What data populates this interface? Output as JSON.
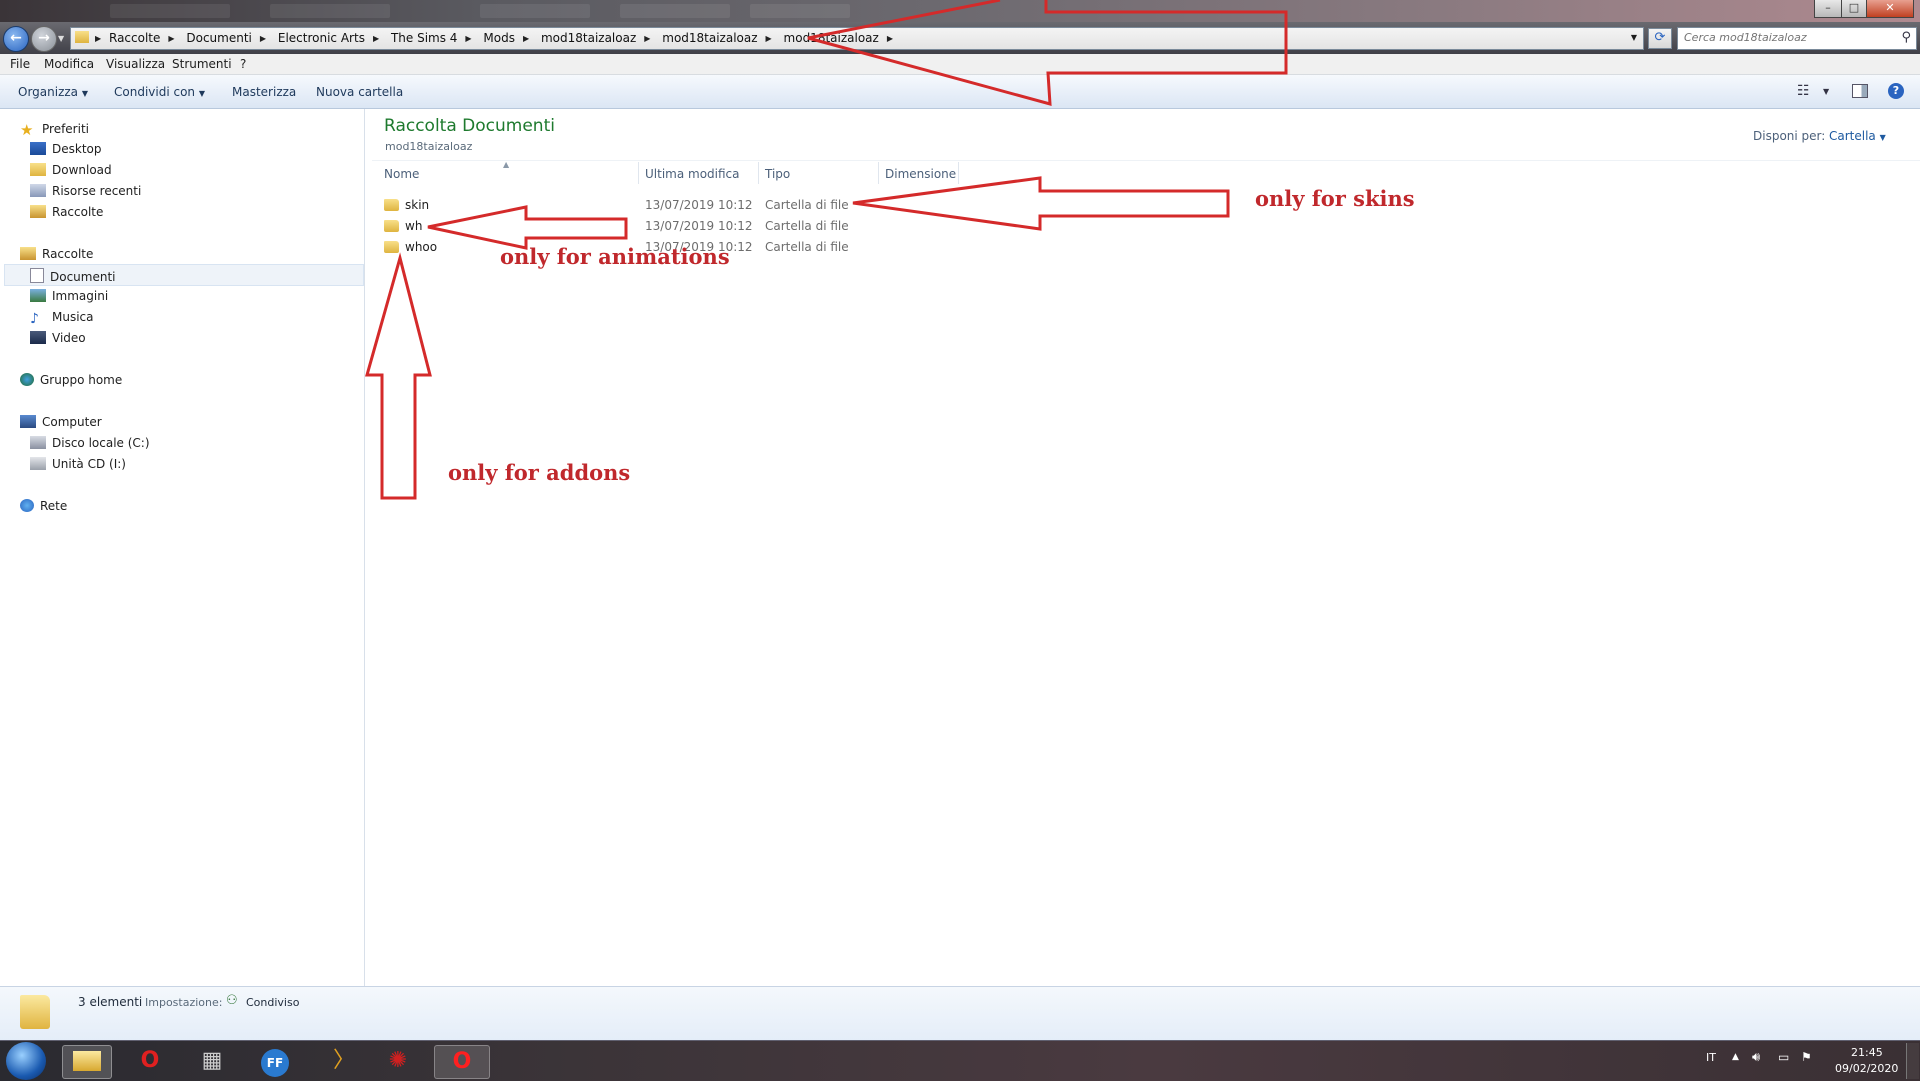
{
  "address": {
    "crumbs": [
      "Raccolte",
      "Documenti",
      "Electronic Arts",
      "The Sims 4",
      "Mods",
      "mod18taizaloaz",
      "mod18taizaloaz",
      "mod18taizaloaz"
    ],
    "search_placeholder": "Cerca mod18taizaloaz"
  },
  "menu": [
    "File",
    "Modifica",
    "Visualizza",
    "Strumenti",
    "?"
  ],
  "commands": {
    "organize": "Organizza",
    "share": "Condividi con",
    "burn": "Masterizza",
    "new_folder": "Nuova cartella"
  },
  "nav": {
    "favorites": "Preferiti",
    "fav_items": [
      "Desktop",
      "Download",
      "Risorse recenti",
      "Raccolte"
    ],
    "libraries": "Raccolte",
    "lib_items": [
      "Documenti",
      "Immagini",
      "Musica",
      "Video"
    ],
    "homegroup": "Gruppo home",
    "computer": "Computer",
    "computer_items": [
      "Disco locale (C:)",
      "Unità CD (I:)"
    ],
    "network": "Rete"
  },
  "content": {
    "library_title": "Raccolta Documenti",
    "subtitle": "mod18taizaloaz",
    "arrange_label": "Disponi per:",
    "arrange_value": "Cartella",
    "columns": [
      "Nome",
      "Ultima modifica",
      "Tipo",
      "Dimensione"
    ],
    "files": [
      {
        "name": "skin",
        "modified": "13/07/2019 10:12",
        "type": "Cartella di file"
      },
      {
        "name": "wh",
        "modified": "13/07/2019 10:12",
        "type": "Cartella di file"
      },
      {
        "name": "whoo",
        "modified": "13/07/2019 10:12",
        "type": "Cartella di file"
      }
    ]
  },
  "status": {
    "count": "3 elementi",
    "setting_label": "Impostazione:",
    "setting_value": "Condiviso"
  },
  "tray": {
    "lang": "IT",
    "time": "21:45",
    "date": "09/02/2020"
  },
  "annotations": {
    "skins": "only for skins",
    "animations": "only for animations",
    "addons": "only for addons"
  },
  "colors": {
    "annotation_red": "#c0282c",
    "library_title": "#1e7a2e"
  }
}
